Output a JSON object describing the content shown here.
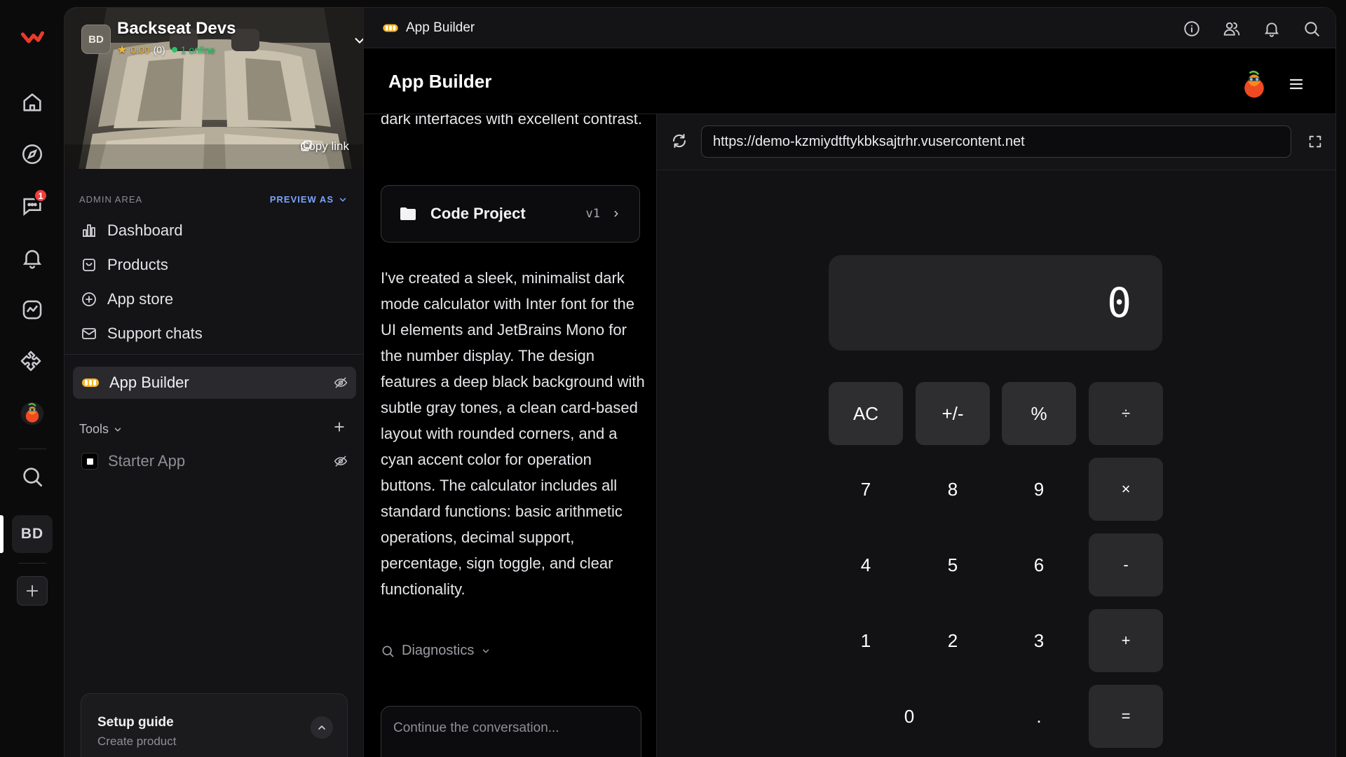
{
  "workspace": {
    "initials": "BD",
    "name": "Backseat Devs",
    "rating": "0.00",
    "rating_count": "(0)",
    "online": "1 online",
    "copy_link": "Copy link"
  },
  "rail": {
    "chat_badge": "1",
    "user_initials": "BD"
  },
  "admin": {
    "section_label": "ADMIN AREA",
    "preview_as": "PREVIEW AS",
    "items": [
      {
        "label": "Dashboard",
        "icon": "chart-bar-icon"
      },
      {
        "label": "Products",
        "icon": "bag-icon"
      },
      {
        "label": "App store",
        "icon": "plus-circle-icon"
      },
      {
        "label": "Support chats",
        "icon": "mail-icon"
      }
    ]
  },
  "apps": {
    "active_label": "App Builder",
    "tools_label": "Tools",
    "tool_items": [
      {
        "label": "Starter App"
      }
    ]
  },
  "setup_guide": {
    "title": "Setup guide",
    "subtitle": "Create product"
  },
  "topbar": {
    "title": "App Builder"
  },
  "header": {
    "title": "App Builder"
  },
  "chat": {
    "cut_text": "dark interfaces with excellent contrast.",
    "code_card": {
      "name": "Code Project",
      "version": "v1"
    },
    "message": "I've created a sleek, minimalist dark mode calculator with Inter font for the UI elements and JetBrains Mono for the number display. The design features a deep black background with subtle gray tones, a clean card-based layout with rounded corners, and a cyan accent color for operation buttons. The calculator includes all standard functions: basic arithmetic operations, decimal support, percentage, sign toggle, and clear functionality.",
    "diagnostics": "Diagnostics",
    "composer_placeholder": "Continue the conversation..."
  },
  "preview": {
    "url": "https://demo-kzmiydtftykbksajtrhr.vusercontent.net"
  },
  "calculator": {
    "display": "0",
    "keys": {
      "ac": "AC",
      "sign": "+/-",
      "percent": "%",
      "divide": "÷",
      "seven": "7",
      "eight": "8",
      "nine": "9",
      "multiply": "×",
      "four": "4",
      "five": "5",
      "six": "6",
      "minus": "-",
      "one": "1",
      "two": "2",
      "three": "3",
      "plus": "+",
      "zero": "0",
      "decimal": ".",
      "equals": "="
    }
  },
  "colors": {
    "accent_blue": "#7aa4ff",
    "online_green": "#29c36a",
    "star_gold": "#f5b728",
    "badge_red": "#ef3e3e",
    "brand_red": "#ea3a2a"
  }
}
